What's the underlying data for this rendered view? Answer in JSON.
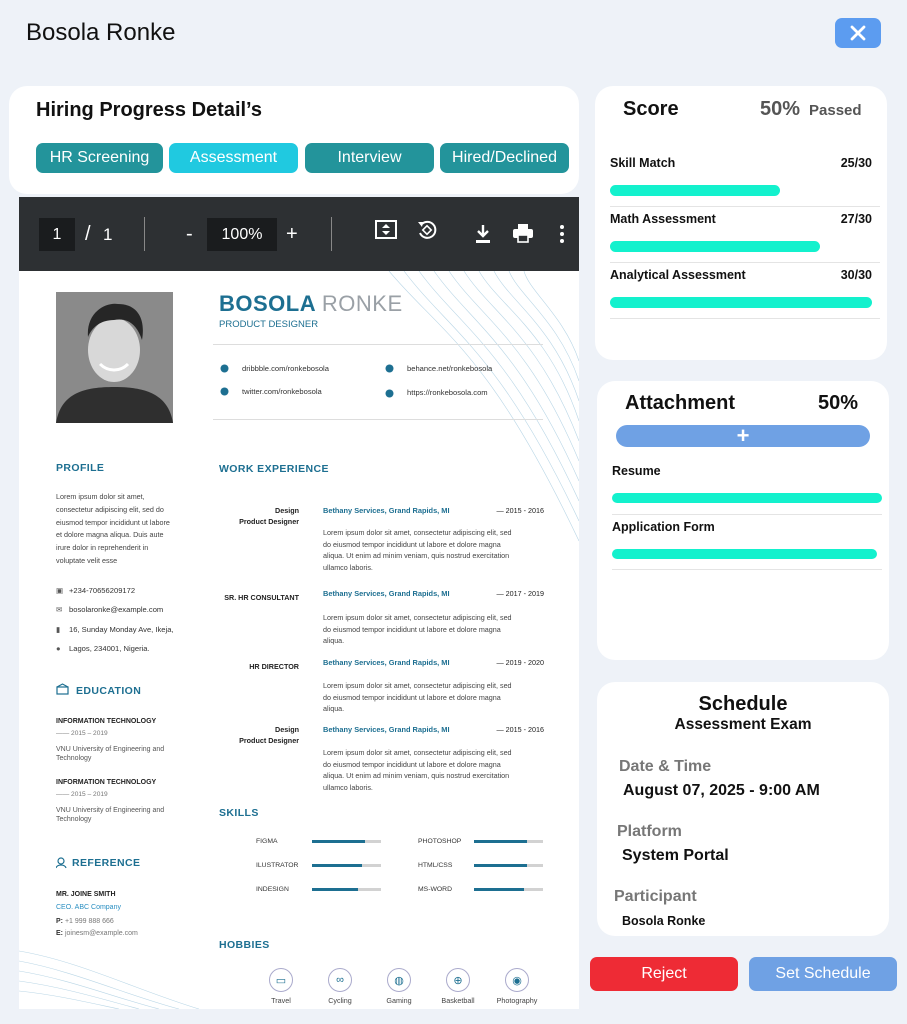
{
  "header": {
    "title": "Bosola Ronke"
  },
  "hiring": {
    "title": "Hiring Progress Detail’s",
    "tabs": [
      "HR Screening",
      "Assessment",
      "Interview",
      "Hired/Declined"
    ],
    "active_tab": "Assessment"
  },
  "viewer": {
    "page_current": "1",
    "page_sep": "/",
    "page_total": "1",
    "zoom_out": "-",
    "zoom": "100%",
    "zoom_in": "+"
  },
  "resume": {
    "first_name": "BOSOLA",
    "last_name": "RONKE",
    "role": "PRODUCT DESIGNER",
    "links": [
      "dribbble.com/ronkebosola",
      "behance.net/ronkebosola",
      "twitter.com/ronkebosola",
      "https://ronkebosola.com"
    ],
    "profile_heading": "PROFILE",
    "profile_text": [
      "Lorem ipsum dolor sit amet,",
      "consectetur adipiscing elit, sed do",
      "eiusmod tempor incididunt ut labore",
      "et dolore magna aliqua. Duis aute",
      "irure dolor in reprehenderit in",
      "voluptate velit esse"
    ],
    "contacts": [
      "+234-70656209172",
      "bosolaronke@example.com",
      "16, Sunday Monday Ave, Ikeja,",
      "Lagos, 234001, Nigeria."
    ],
    "education_heading": "EDUCATION",
    "education": [
      {
        "title": "INFORMATION TECHNOLOGY",
        "years": "2015 – 2019",
        "school1": "VNU University of Engineering and",
        "school2": "Technology"
      },
      {
        "title": "INFORMATION TECHNOLOGY",
        "years": "2015 – 2019",
        "school1": "VNU University of Engineering and",
        "school2": "Technology"
      }
    ],
    "reference_heading": "REFERENCE",
    "reference": {
      "name": "MR. JOINE SMITH",
      "company": "CEO. ABC Company",
      "phone_label": "P:",
      "phone": "+1 999 888 666",
      "email_label": "E:",
      "email": "joinesm@example.com"
    },
    "work_heading": "WORK EXPERIENCE",
    "jobs": [
      {
        "title1": "Design",
        "title2": "Product Designer",
        "company": "Bethany Services, Grand Rapids, MI",
        "years": "2015 - 2016",
        "text": [
          "Lorem ipsum dolor sit amet, consectetur adipiscing elit, sed",
          "do eiusmod tempor incididunt ut labore et dolore magna",
          "aliqua. Ut enim ad minim veniam, quis nostrud exercitation",
          "ullamco laboris."
        ]
      },
      {
        "title1": "SR. HR CONSULTANT",
        "title2": "",
        "company": "Bethany Services, Grand Rapids, MI",
        "years": "2017 - 2019",
        "text": [
          "Lorem ipsum dolor sit amet, consectetur adipiscing elit, sed",
          "do eiusmod tempor incididunt ut labore et dolore magna",
          "aliqua."
        ]
      },
      {
        "title1": "HR DIRECTOR",
        "title2": "",
        "company": "Bethany Services, Grand Rapids, MI",
        "years": "2019 - 2020",
        "text": [
          "Lorem ipsum dolor sit amet, consectetur adipiscing elit, sed",
          "do eiusmod tempor incididunt ut labore et dolore magna",
          "aliqua."
        ]
      },
      {
        "title1": "Design",
        "title2": "Product Designer",
        "company": "Bethany Services, Grand Rapids, MI",
        "years": "2015 - 2016",
        "text": [
          "Lorem ipsum dolor sit amet, consectetur adipiscing elit, sed",
          "do eiusmod tempor incididunt ut labore et dolore magna",
          "aliqua. Ut enim ad minim veniam, quis nostrud exercitation",
          "ullamco laboris."
        ]
      }
    ],
    "skills_heading": "SKILLS",
    "skills": [
      {
        "name": "FIGMA",
        "level": 0.77
      },
      {
        "name": "PHOTOSHOP",
        "level": 0.77
      },
      {
        "name": "ILUSTRATOR",
        "level": 0.73
      },
      {
        "name": "HTML/CSS",
        "level": 0.77
      },
      {
        "name": "INDESIGN",
        "level": 0.66
      },
      {
        "name": "MS-WORD",
        "level": 0.72
      }
    ],
    "hobbies_heading": "HOBBIES",
    "hobbies": [
      "Travel",
      "Cycling",
      "Gaming",
      "Basketball",
      "Photography"
    ]
  },
  "score": {
    "title": "Score",
    "percent": "50%",
    "status": "Passed",
    "items": [
      {
        "label": "Skill Match",
        "value": "25/30",
        "fraction": 0.65
      },
      {
        "label": "Math Assessment",
        "value": "27/30",
        "fraction": 0.8
      },
      {
        "label": "Analytical Assessment",
        "value": "30/30",
        "fraction": 1.0
      }
    ]
  },
  "attachment": {
    "title": "Attachment",
    "percent": "50%",
    "add_symbol": "+",
    "items": [
      {
        "label": "Resume",
        "fraction": 1.0
      },
      {
        "label": "Application Form",
        "fraction": 0.98
      }
    ]
  },
  "schedule": {
    "title": "Schedule",
    "subtitle": "Assessment Exam",
    "date_label": "Date & Time",
    "date_value": "August 07, 2025 - 9:00 AM",
    "platform_label": "Platform",
    "platform_value": "System Portal",
    "participant_label": "Participant",
    "participant_value": "Bosola Ronke"
  },
  "actions": {
    "reject": "Reject",
    "set_schedule": "Set Schedule"
  },
  "colors": {
    "teal_tab": "#23949b",
    "active_tab": "#20c9e0",
    "progress": "#13f1cd",
    "reject": "#ee2b35",
    "schedule_btn": "#6fa1e4",
    "close_btn": "#5c9cf0"
  }
}
